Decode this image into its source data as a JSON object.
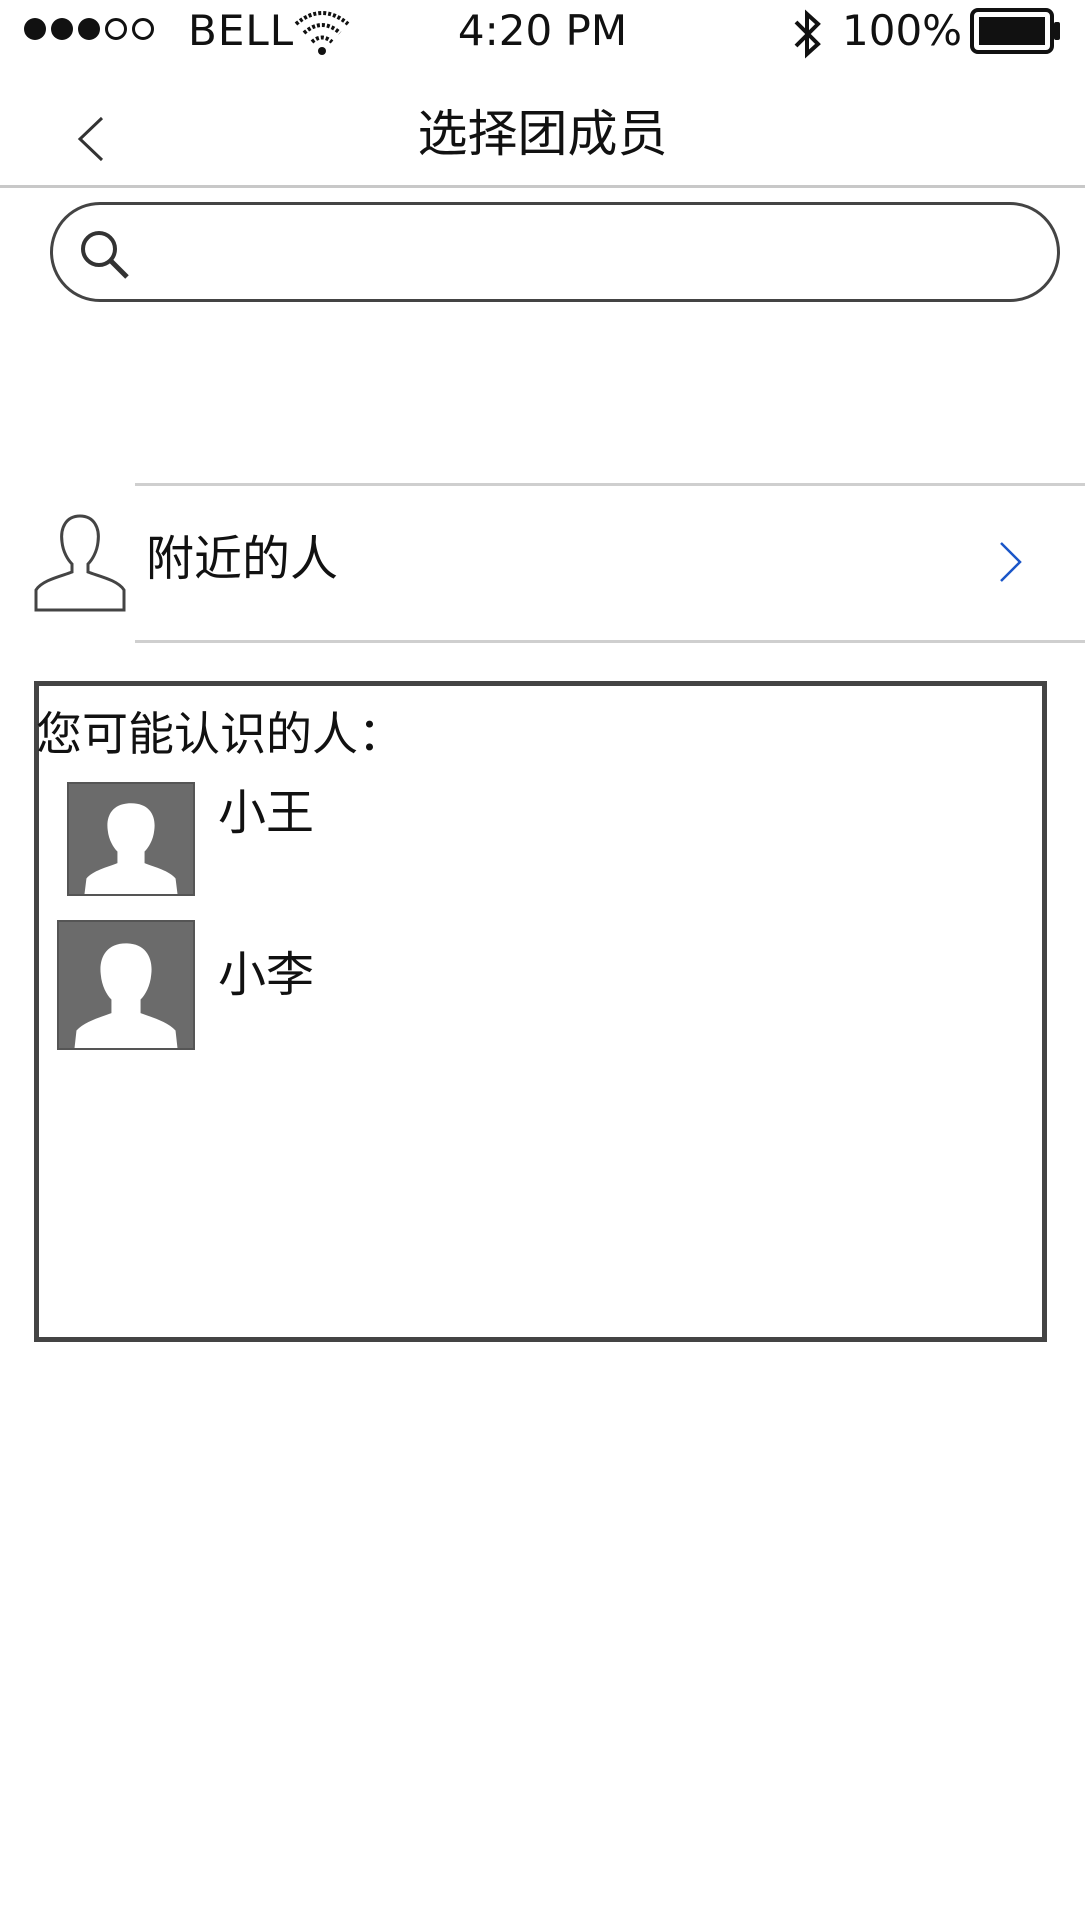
{
  "status_bar": {
    "carrier": "BELL",
    "time": "4:20 PM",
    "battery": "100%",
    "signal_full": 3,
    "signal_empty": 2
  },
  "nav": {
    "title": "选择团成员",
    "back_icon": "chevron-left-icon"
  },
  "search": {
    "placeholder": "",
    "value": "",
    "icon": "search-icon"
  },
  "nearby": {
    "label": "附近的人",
    "icon": "person-outline-icon",
    "chevron_icon": "chevron-right-icon"
  },
  "suggestions": {
    "title": "您可能认识的人：",
    "contacts": [
      {
        "name": "小王",
        "avatar_icon": "avatar-placeholder-icon"
      },
      {
        "name": "小李",
        "avatar_icon": "avatar-placeholder-icon"
      }
    ]
  },
  "colors": {
    "chevron_accent": "#1a56c8",
    "divider": "#c8c8c8",
    "border": "#444444",
    "avatar_bg": "#6b6b6b"
  }
}
